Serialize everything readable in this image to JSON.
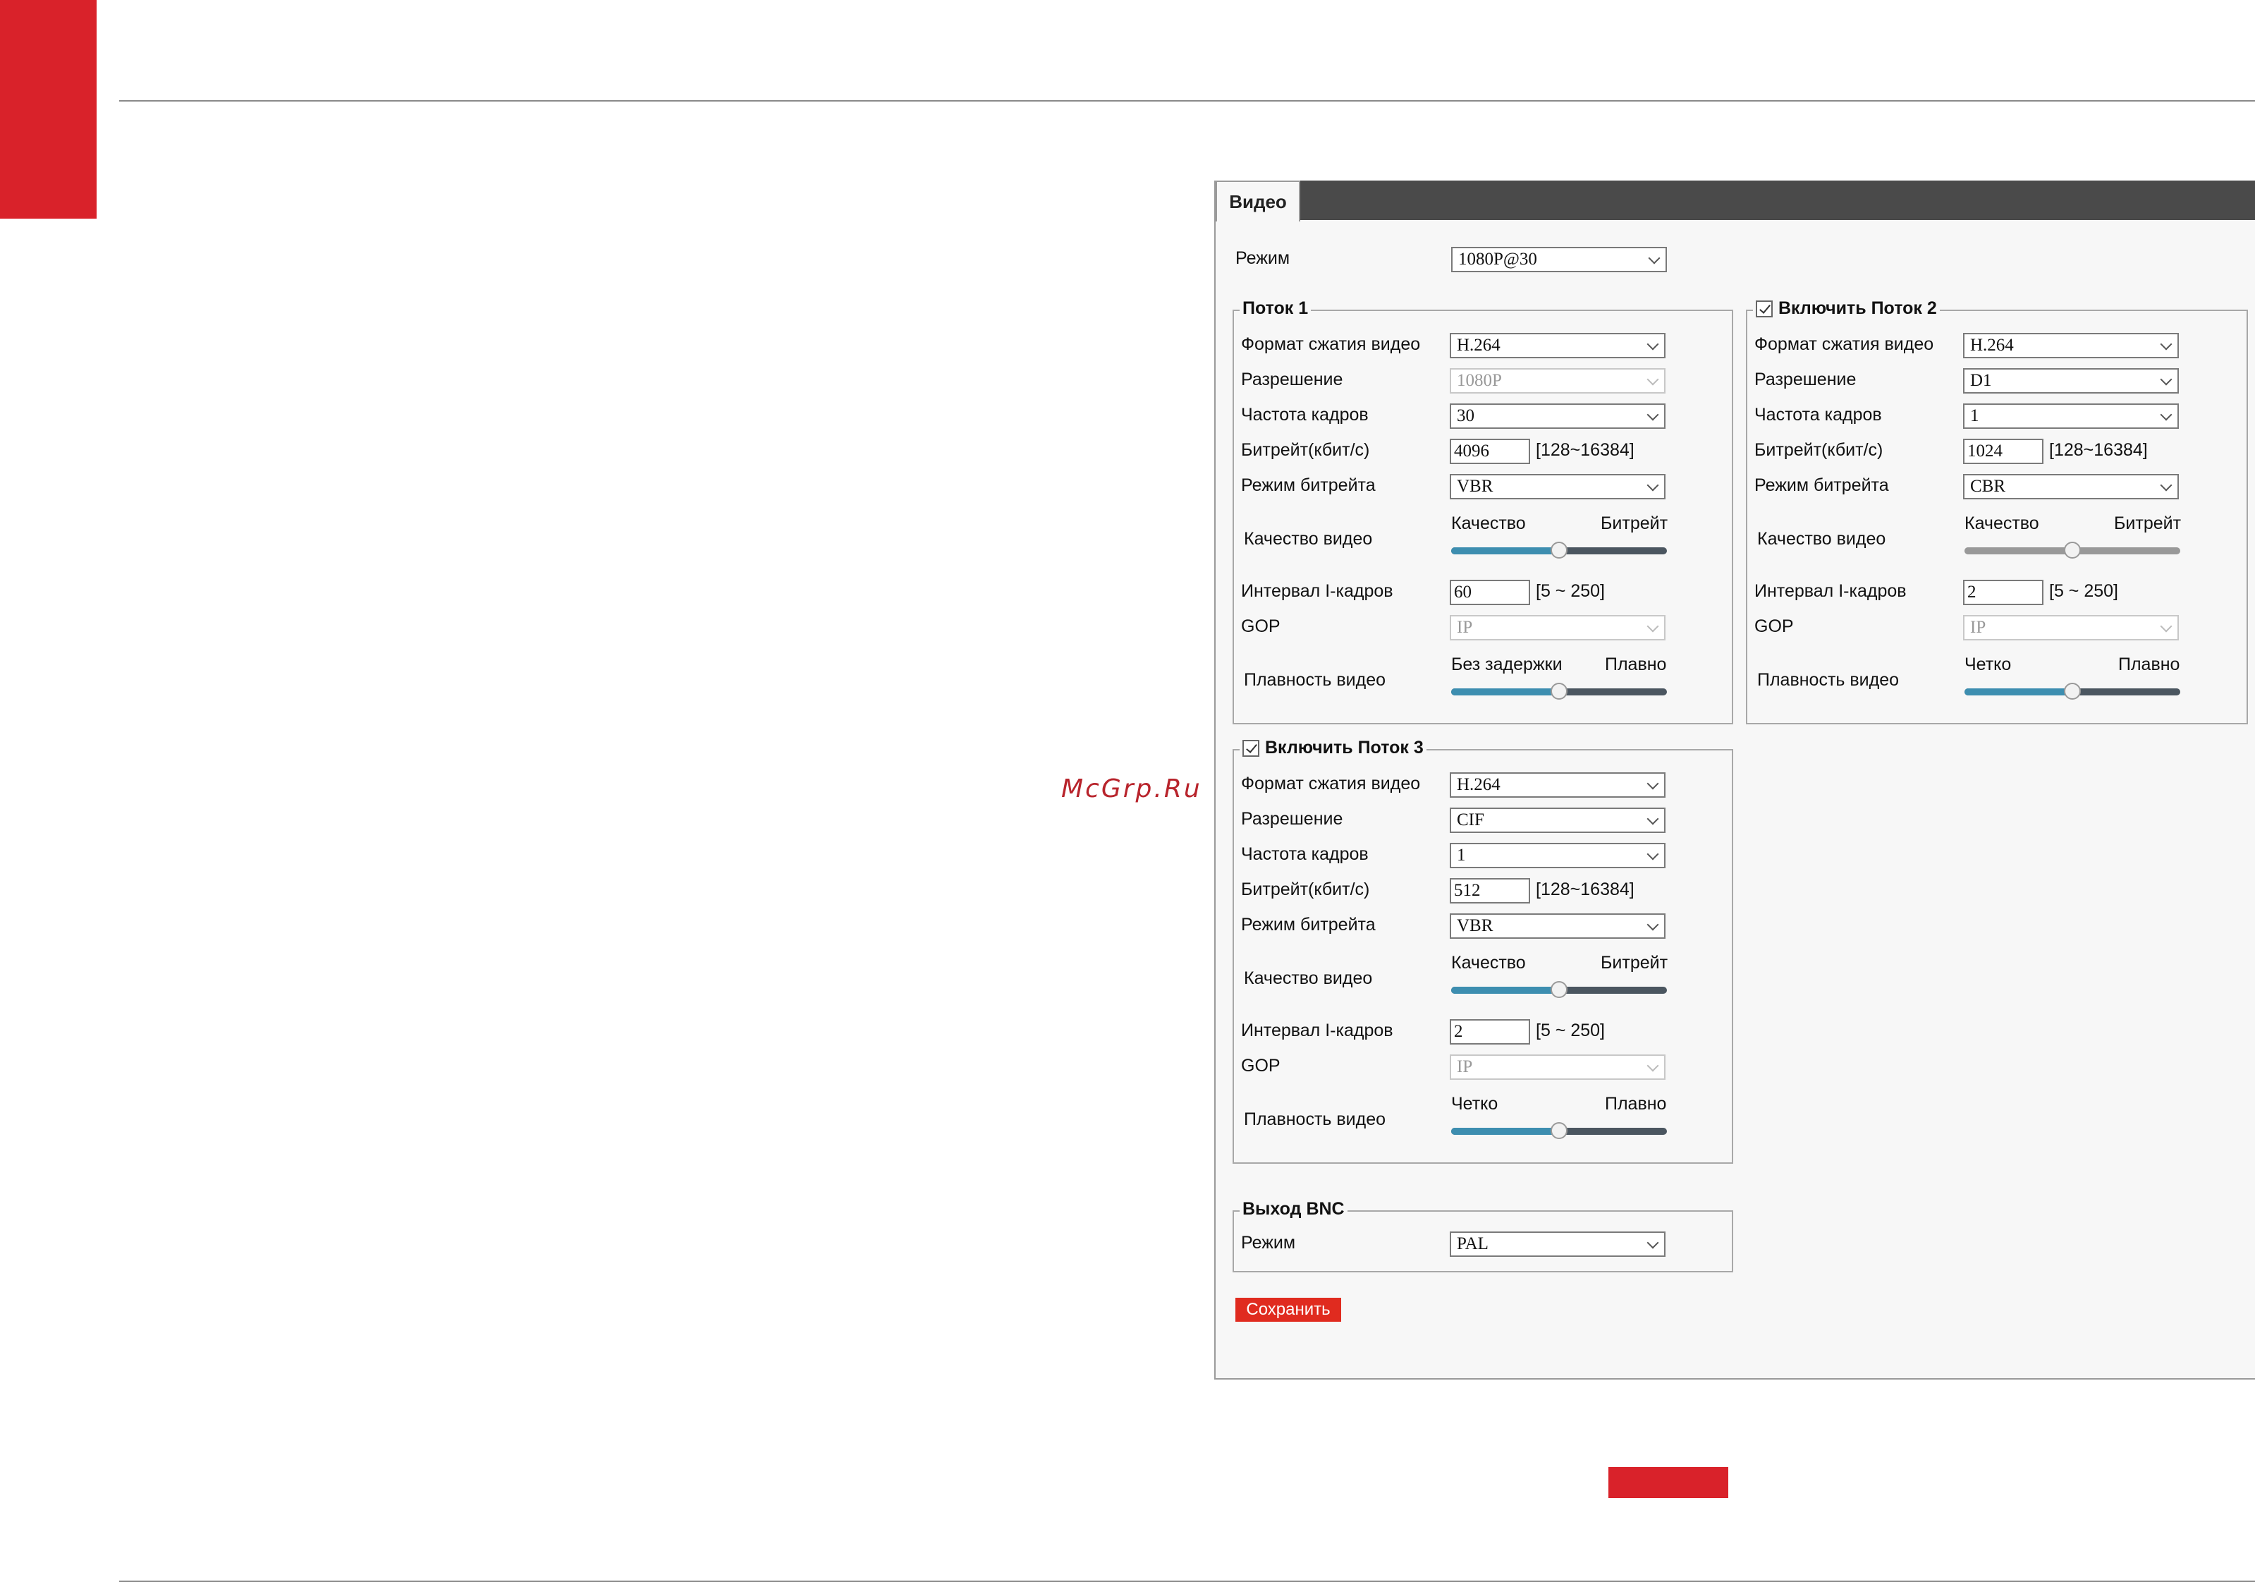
{
  "watermark": "McGrp.Ru",
  "tabs": {
    "video": "Видео"
  },
  "mode_label": "Режим",
  "mode_value": "1080P@30",
  "stream1": {
    "title": "Поток 1",
    "codec_label": "Формат сжатия видео",
    "codec": "H.264",
    "res_label": "Разрешение",
    "res": "1080P",
    "fps_label": "Частота кадров",
    "fps": "30",
    "bitrate_label": "Битрейт(кбит/с)",
    "bitrate": "4096",
    "bitrate_range": "[128~16384]",
    "brmode_label": "Режим битрейта",
    "brmode": "VBR",
    "quality_label": "Качество видео",
    "quality_left": "Качество",
    "quality_right": "Битрейт",
    "quality_level": 0.5,
    "iframe_label": "Интервал I-кадров",
    "iframe": "60",
    "iframe_range": "[5 ~ 250]",
    "gop_label": "GOP",
    "gop": "IP",
    "smooth_label": "Плавность видео",
    "smooth_left": "Без задержки",
    "smooth_right": "Плавно",
    "smooth_level": 0.5
  },
  "stream2": {
    "title": "Включить Поток 2",
    "enabled": true,
    "codec_label": "Формат сжатия видео",
    "codec": "H.264",
    "res_label": "Разрешение",
    "res": "D1",
    "fps_label": "Частота кадров",
    "fps": "1",
    "bitrate_label": "Битрейт(кбит/с)",
    "bitrate": "1024",
    "bitrate_range": "[128~16384]",
    "brmode_label": "Режим битрейта",
    "brmode": "CBR",
    "quality_label": "Качество видео",
    "quality_left": "Качество",
    "quality_right": "Битрейт",
    "quality_level": 0.5,
    "iframe_label": "Интервал I-кадров",
    "iframe": "2",
    "iframe_range": "[5 ~ 250]",
    "gop_label": "GOP",
    "gop": "IP",
    "smooth_label": "Плавность видео",
    "smooth_left": "Четко",
    "smooth_right": "Плавно",
    "smooth_level": 0.5
  },
  "stream3": {
    "title": "Включить Поток 3",
    "enabled": true,
    "codec_label": "Формат сжатия видео",
    "codec": "H.264",
    "res_label": "Разрешение",
    "res": "CIF",
    "fps_label": "Частота кадров",
    "fps": "1",
    "bitrate_label": "Битрейт(кбит/с)",
    "bitrate": "512",
    "bitrate_range": "[128~16384]",
    "brmode_label": "Режим битрейта",
    "brmode": "VBR",
    "quality_label": "Качество видео",
    "quality_left": "Качество",
    "quality_right": "Битрейт",
    "quality_level": 0.5,
    "iframe_label": "Интервал I-кадров",
    "iframe": "2",
    "iframe_range": "[5 ~ 250]",
    "gop_label": "GOP",
    "gop": "IP",
    "smooth_label": "Плавность видео",
    "smooth_left": "Четко",
    "smooth_right": "Плавно",
    "smooth_level": 0.5
  },
  "bnc": {
    "title": "Выход BNC",
    "mode_label": "Режим",
    "mode": "PAL"
  },
  "save_label": "Сохранить",
  "colors": {
    "accent_red": "#d9222a",
    "save_button": "#e02b1f",
    "slider_fill": "#3d8eb0",
    "tabbar": "#4a4a4a"
  }
}
